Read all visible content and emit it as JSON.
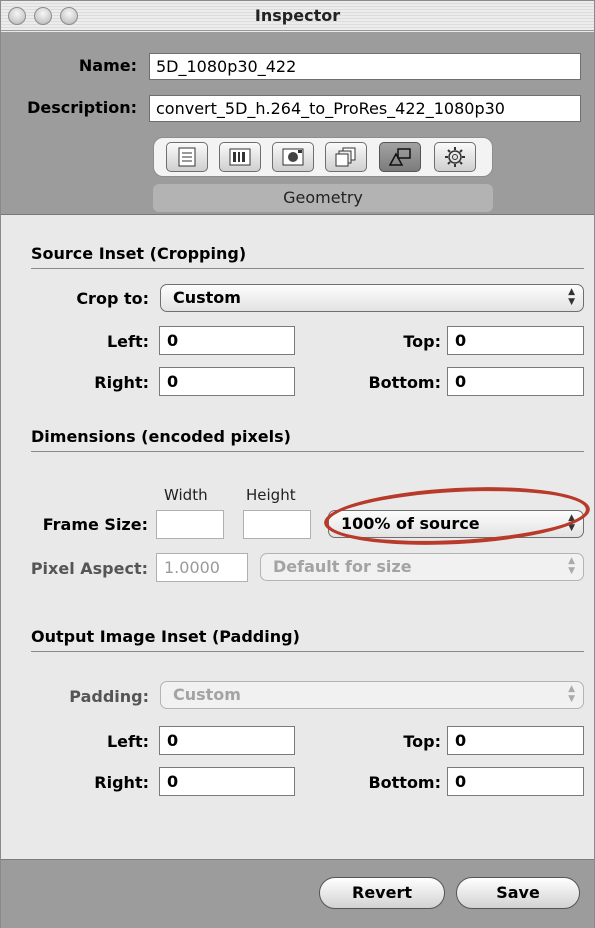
{
  "window": {
    "title": "Inspector"
  },
  "header": {
    "name_label": "Name:",
    "name_value": "5D_1080p30_422",
    "description_label": "Description:",
    "description_value": "convert_5D_h.264_to_ProRes_422_1080p30",
    "tabs": [
      {
        "icon": "summary-icon"
      },
      {
        "icon": "encoder-icon"
      },
      {
        "icon": "frame-controls-icon"
      },
      {
        "icon": "filters-icon"
      },
      {
        "icon": "geometry-icon",
        "active": true
      },
      {
        "icon": "actions-gear-icon"
      }
    ],
    "active_tab_label": "Geometry"
  },
  "source_inset": {
    "title": "Source Inset (Cropping)",
    "crop_label": "Crop to:",
    "crop_value": "Custom",
    "left_label": "Left:",
    "left_value": "0",
    "top_label": "Top:",
    "top_value": "0",
    "right_label": "Right:",
    "right_value": "0",
    "bottom_label": "Bottom:",
    "bottom_value": "0"
  },
  "dimensions": {
    "title": "Dimensions (encoded pixels)",
    "width_header": "Width",
    "height_header": "Height",
    "frame_size_label": "Frame Size:",
    "frame_size_value": "100% of source",
    "pixel_aspect_label": "Pixel Aspect:",
    "pixel_aspect_value": "1.0000",
    "pixel_aspect_preset": "Default for size"
  },
  "output_inset": {
    "title": "Output Image Inset (Padding)",
    "padding_label": "Padding:",
    "padding_value": "Custom",
    "left_label": "Left:",
    "left_value": "0",
    "top_label": "Top:",
    "top_value": "0",
    "right_label": "Right:",
    "right_value": "0",
    "bottom_label": "Bottom:",
    "bottom_value": "0"
  },
  "footer": {
    "revert_label": "Revert",
    "save_label": "Save"
  },
  "colors": {
    "highlight": "#b73a2a",
    "header_bg": "#9c9c9c",
    "panel_bg": "#e9e9e9"
  }
}
